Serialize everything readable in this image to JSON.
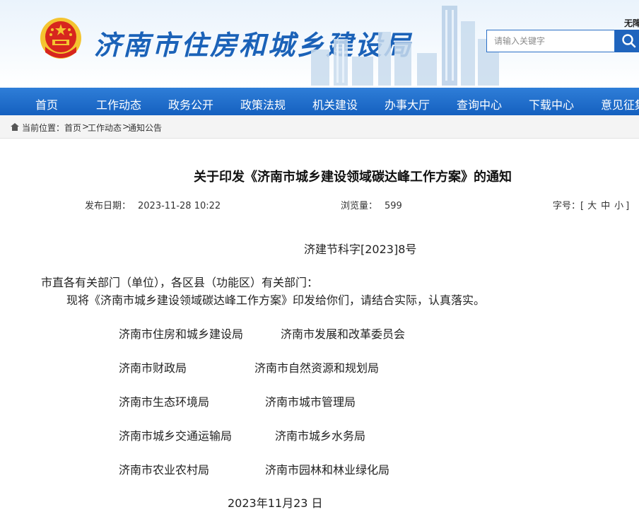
{
  "header": {
    "site_title": "济南市住房和城乡建设局",
    "access_link": "无障",
    "search_placeholder": "请输入关键字"
  },
  "nav": {
    "items": [
      "首页",
      "工作动态",
      "政务公开",
      "政策法规",
      "机关建设",
      "办事大厅",
      "查询中心",
      "下载中心",
      "意见征集"
    ]
  },
  "breadcrumb": {
    "label": "当前位置：",
    "items": [
      "首页",
      "工作动态",
      "通知公告"
    ],
    "separator": ">"
  },
  "article": {
    "title": "关于印发《济南市城乡建设领域碳达峰工作方案》的通知",
    "publish_label": "发布日期：",
    "publish_date": "2023-11-28 10:22",
    "views_label": "浏览量：",
    "views": "599",
    "font_size_label": "字号：",
    "font_size_open": "[",
    "font_size_options": [
      "大",
      "中",
      "小"
    ],
    "font_size_close": "]",
    "doc_number": "济建节科字[2023]8号",
    "salutation": "市直各有关部门（单位），各区县（功能区）有关部门：",
    "paragraph": "现将《济南市城乡建设领域碳达峰工作方案》印发给你们，请结合实际，认真落实。",
    "issuers": [
      [
        "济南市住房和城乡建设局",
        "济南市发展和改革委员会"
      ],
      [
        "济南市财政局",
        "济南市自然资源和规划局"
      ],
      [
        "济南市生态环境局",
        "济南市城市管理局"
      ],
      [
        "济南市城乡交通运输局",
        "济南市城乡水务局"
      ],
      [
        "济南市农业农村局",
        "济南市园林和林业绿化局"
      ]
    ],
    "date": "2023年11月23 日"
  },
  "colors": {
    "brand_blue": "#1b62b8",
    "nav_blue": "#1f68c6",
    "emblem_red": "#d7261e",
    "emblem_gold": "#f4c430"
  },
  "icons": {
    "emblem": "national-emblem-icon",
    "search": "search-icon",
    "breadcrumb": "home-icon"
  }
}
